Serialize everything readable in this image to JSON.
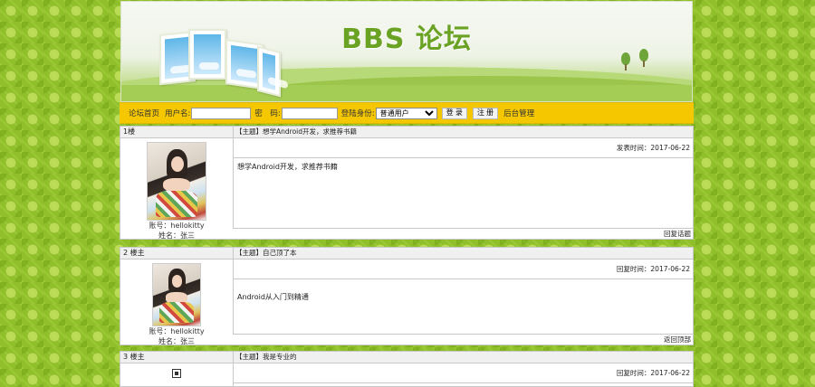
{
  "banner": {
    "title": "BBS 论坛"
  },
  "toolbar": {
    "home_link": "论坛首页",
    "username_label": "用户名:",
    "username_value": "",
    "password_label": "密　码:",
    "password_value": "",
    "role_label": "登陆身份:",
    "role_selected": "普通用户",
    "login_button": "登 录",
    "register_button": "注 册",
    "admin_link": "后台管理"
  },
  "posts": [
    {
      "floor": "1楼",
      "account_label": "账号：",
      "account": "hellokitty",
      "name_label": "姓名：",
      "name": "张三",
      "subject_tag": "【主题】",
      "subject": "想学Android开发，求推荐书籍",
      "time_label": "发表时间：",
      "time": "2017-06-22",
      "content": "想学Android开发，求推荐书籍",
      "footer_link": "回复话题"
    },
    {
      "floor": "2 楼主",
      "account_label": "账号：",
      "account": "hellokitty",
      "name_label": "姓名：",
      "name": "张三",
      "subject_tag": "【主题】",
      "subject": "自己顶了本",
      "time_label": "回复时间：",
      "time": "2017-06-22",
      "content": "Android从入门到精通",
      "footer_link": "返回顶部"
    },
    {
      "floor": "3 楼主",
      "subject_tag": "【主题】",
      "subject": "我是专业的",
      "time_label": "回复时间：",
      "time": "2017-06-22"
    }
  ]
}
